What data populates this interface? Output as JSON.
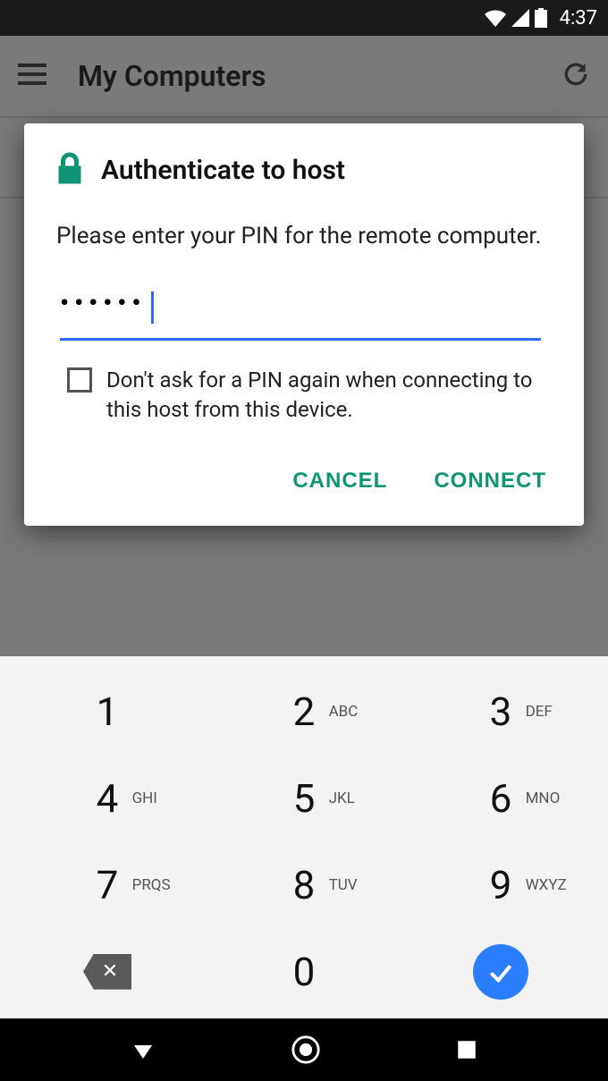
{
  "status": {
    "time": "4:37"
  },
  "appbar": {
    "title": "My Computers"
  },
  "dialog": {
    "title": "Authenticate to host",
    "body": "Please enter your PIN for the remote computer.",
    "pin_mask": "••••••",
    "checkbox_label": "Don't ask for a PIN again when connecting to this host from this device.",
    "cancel": "CANCEL",
    "connect": "CONNECT"
  },
  "keypad": {
    "keys": [
      {
        "digit": "1",
        "letters": ""
      },
      {
        "digit": "2",
        "letters": "ABC"
      },
      {
        "digit": "3",
        "letters": "DEF"
      },
      {
        "digit": "4",
        "letters": "GHI"
      },
      {
        "digit": "5",
        "letters": "JKL"
      },
      {
        "digit": "6",
        "letters": "MNO"
      },
      {
        "digit": "7",
        "letters": "PRQS"
      },
      {
        "digit": "8",
        "letters": "TUV"
      },
      {
        "digit": "9",
        "letters": "WXYZ"
      },
      {
        "digit": "0",
        "letters": ""
      }
    ]
  }
}
